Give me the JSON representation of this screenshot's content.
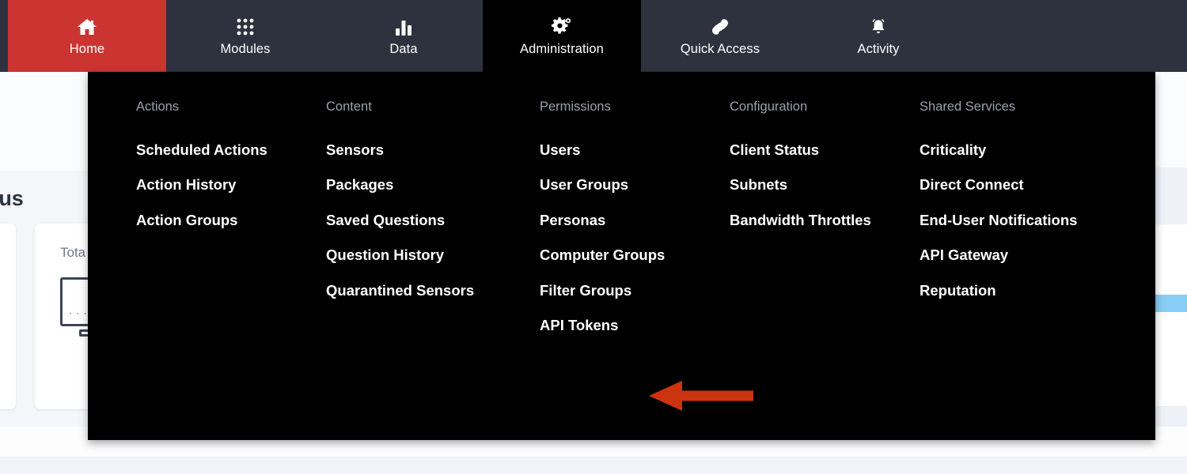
{
  "colors": {
    "nav_background": "#2d323e",
    "home_active": "#cc3432",
    "admin_active": "#000000",
    "menu_background": "#000000",
    "menu_heading_text": "#9aa0ad",
    "menu_item_text": "#ffffff",
    "arrow": "#cc3311",
    "page_background": "#f4f6fa",
    "highlight_blue": "#87cdf5"
  },
  "topnav": {
    "tabs": [
      {
        "label": "Home",
        "icon": "home-icon",
        "state": "active-home"
      },
      {
        "label": "Modules",
        "icon": "grid-icon",
        "state": "inactive"
      },
      {
        "label": "Data",
        "icon": "bar-chart-icon",
        "state": "inactive"
      },
      {
        "label": "Administration",
        "icon": "gear-icon",
        "state": "active-admin"
      },
      {
        "label": "Quick Access",
        "icon": "link-icon",
        "state": "inactive"
      },
      {
        "label": "Activity",
        "icon": "bell-icon",
        "state": "inactive"
      }
    ]
  },
  "megamenu": {
    "open_for": "Administration",
    "columns": [
      {
        "heading": "Actions",
        "items": [
          "Scheduled Actions",
          "Action History",
          "Action Groups"
        ]
      },
      {
        "heading": "Content",
        "items": [
          "Sensors",
          "Packages",
          "Saved Questions",
          "Question History",
          "Quarantined Sensors"
        ]
      },
      {
        "heading": "Permissions",
        "items": [
          "Users",
          "User Groups",
          "Personas",
          "Computer Groups",
          "Filter Groups",
          "API Tokens"
        ]
      },
      {
        "heading": "Configuration",
        "items": [
          "Client Status",
          "Subnets",
          "Bandwidth Throttles"
        ]
      },
      {
        "heading": "Shared Services",
        "items": [
          "Criticality",
          "Direct Connect",
          "End-User Notifications",
          "API Gateway",
          "Reputation"
        ]
      }
    ]
  },
  "annotation": {
    "arrow_name": "left-pointing-arrow",
    "points_at": "API Tokens"
  },
  "background": {
    "section_title": "tatus",
    "card_label": "Tota"
  }
}
